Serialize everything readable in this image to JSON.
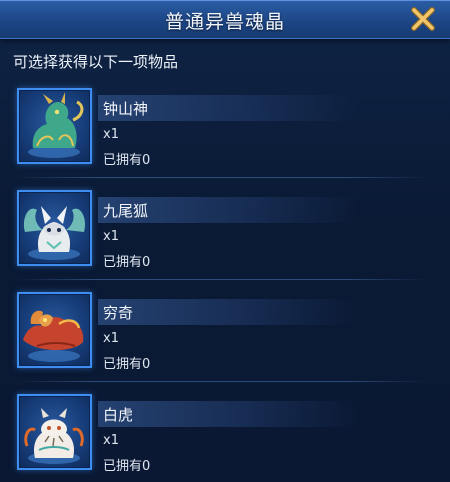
{
  "dialog": {
    "title": "普通异兽魂晶",
    "close_icon": "close-x-icon",
    "subtitle": "可选择获得以下一项物品"
  },
  "items": [
    {
      "name": "钟山神",
      "qty": "x1",
      "owned": "已拥有0",
      "icon": "zhongshanshen-beast-icon"
    },
    {
      "name": "九尾狐",
      "qty": "x1",
      "owned": "已拥有0",
      "icon": "nine-tailed-fox-icon"
    },
    {
      "name": "穷奇",
      "qty": "x1",
      "owned": "已拥有0",
      "icon": "qiongqi-beast-icon"
    },
    {
      "name": "白虎",
      "qty": "x1",
      "owned": "已拥有0",
      "icon": "white-tiger-icon"
    }
  ],
  "colors": {
    "accent_border": "#3e8df0",
    "title_bar": "#1d4686",
    "close_gold": "#f1c56a"
  }
}
